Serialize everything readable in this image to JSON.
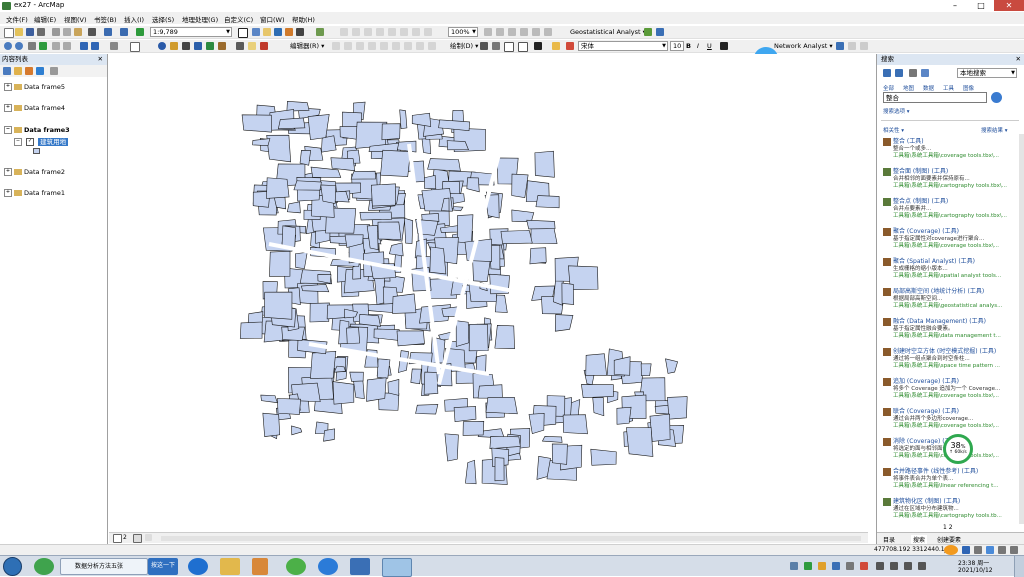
{
  "window": {
    "title": "ex27 - ArcMap"
  },
  "menu": [
    "文件(F)",
    "编辑(E)",
    "视图(V)",
    "书签(B)",
    "插入(I)",
    "选择(S)",
    "地理处理(G)",
    "自定义(C)",
    "窗口(W)",
    "帮助(H)"
  ],
  "toolbar": {
    "scale": "1:9,789",
    "geostat_label": "Geostatistical Analyst ▾",
    "zoom_percent": "100%",
    "editor_label": "编辑器(R) ▾",
    "draw_label": "绘制(D) ▾",
    "font_name": "宋体",
    "font_size": "10",
    "network_label": "Network Analyst ▾",
    "badge": "00:09"
  },
  "toc": {
    "header": "内容列表",
    "frames": [
      "Data frame5",
      "Data frame4",
      "Data frame3",
      "Data frame2",
      "Data frame1"
    ],
    "active_layer": "建筑用地"
  },
  "search": {
    "header": "搜索",
    "scope": "本地搜索",
    "tabs": [
      "全部",
      "地图",
      "数据",
      "工具",
      "图像"
    ],
    "query": "整合",
    "options": "搜索选项 ▾",
    "sort_left": "相关性 ▾",
    "sort_right": "搜索结果 ▾",
    "results": [
      {
        "title": "整合 (工具)",
        "desc": "整合一个或多...",
        "path": "工具箱\\系统工具箱\\coverage tools.tbx\\..."
      },
      {
        "title": "整合面 (制图) (工具)",
        "desc": "合并相邻的面要素并保持原有...",
        "path": "工具箱\\系统工具箱\\cartography tools.tbx\\..."
      },
      {
        "title": "整合点 (制图) (工具)",
        "desc": "合并点要素并...",
        "path": "工具箱\\系统工具箱\\cartography tools.tbx\\..."
      },
      {
        "title": "聚合 (Coverage) (工具)",
        "desc": "基于指定属性对coverage进行聚合...",
        "path": "工具箱\\系统工具箱\\coverage tools.tbx\\..."
      },
      {
        "title": "聚合 (Spatial Analyst) (工具)",
        "desc": "生成栅格的缩小版本...",
        "path": "工具箱\\系统工具箱\\spatial analyst tools..."
      },
      {
        "title": "局部高斯空间 (地统计分析) (工具)",
        "desc": "根据局部高斯空间...",
        "path": "工具箱\\系统工具箱\\geostatistical analys..."
      },
      {
        "title": "融合 (Data Management) (工具)",
        "desc": "基于指定属性融合要素。",
        "path": "工具箱\\系统工具箱\\data management t..."
      },
      {
        "title": "创建时空立方体 (时空模式挖掘) (工具)",
        "desc": "通过将一组点聚合到时空条柱...",
        "path": "工具箱\\系统工具箱\\space time pattern ..."
      },
      {
        "title": "追加 (Coverage) (工具)",
        "desc": "将多个 Coverage 追加为一个 Coverage...",
        "path": "工具箱\\系统工具箱\\coverage tools.tbx\\..."
      },
      {
        "title": "联合 (Coverage) (工具)",
        "desc": "通过合并两个多边形coverage...",
        "path": "工具箱\\系统工具箱\\coverage tools.tbx\\..."
      },
      {
        "title": "消除 (Coverage) (工具)",
        "desc": "将选定的面与相邻面合并...",
        "path": "工具箱\\系统工具箱\\coverage tools.tbx\\..."
      },
      {
        "title": "合并路径事件 (线性参考) (工具)",
        "desc": "将事件表合并为单个表...",
        "path": "工具箱\\系统工具箱\\linear referencing t..."
      },
      {
        "title": "建筑物化区 (制图) (工具)",
        "desc": "通过在区域中分布建筑物...",
        "path": "工具箱\\系统工具箱\\cartography tools.tb..."
      }
    ],
    "bottom_tabs": [
      "目录",
      "搜索",
      "创建要素"
    ],
    "gauge_value": "38",
    "gauge_unit": "%",
    "gauge_rate": "↑ 60k/s",
    "pagination": "1 2"
  },
  "status": {
    "coords": "477708.192  3312440.1",
    "units": "米"
  },
  "map_status": {
    "page": "2"
  },
  "taskbar": {
    "items": [
      "数据分析方法五张",
      "按这一下"
    ],
    "time": "23:38 周一",
    "date": "2021/10/12"
  },
  "colors": {
    "parcel_fill": "#c5d3f0",
    "parcel_stroke": "#1a1a1a",
    "toc_head": "#dce6f2",
    "link": "#1f4e9b",
    "path": "#2e8b2e"
  }
}
